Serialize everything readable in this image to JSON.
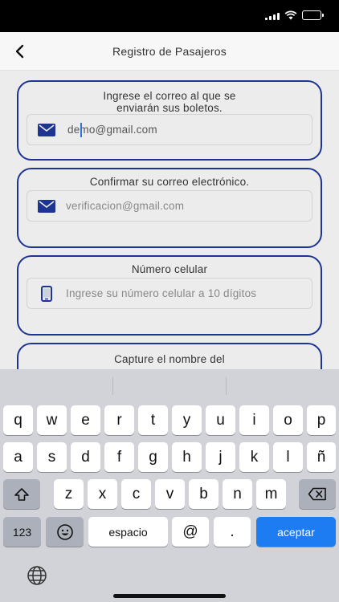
{
  "status_bar": {
    "icons": [
      "signal-icon",
      "wifi-icon",
      "battery-icon"
    ]
  },
  "nav": {
    "title": "Registro de Pasajeros",
    "back_icon": "chevron-left-icon"
  },
  "form": {
    "email_card": {
      "label": "Ingrese el correo al que se enviarán sus boletos.",
      "value": "demo@gmail.com",
      "icon": "mail-icon"
    },
    "confirm_card": {
      "label": "Confirmar su correo electrónico.",
      "placeholder": "verificacion@gmail.com",
      "icon": "mail-icon"
    },
    "phone_card": {
      "label": "Número celular",
      "placeholder": "Ingrese su número celular a 10 dígitos",
      "icon": "phone-icon"
    },
    "name_card": {
      "label": "Capture el nombre del"
    }
  },
  "keyboard": {
    "row1": [
      "q",
      "w",
      "e",
      "r",
      "t",
      "y",
      "u",
      "i",
      "o",
      "p"
    ],
    "row2": [
      "a",
      "s",
      "d",
      "f",
      "g",
      "h",
      "j",
      "k",
      "l",
      "ñ"
    ],
    "row3": [
      "z",
      "x",
      "c",
      "v",
      "b",
      "n",
      "m"
    ],
    "numbers_key": "123",
    "space_key": "espacio",
    "at_key": "@",
    "dot_key": ".",
    "return_key": "aceptar",
    "colors": {
      "background": "#d1d3d9",
      "key": "#ffffff",
      "special_key": "#abb0ba",
      "return_key": "#1e7cf2"
    }
  },
  "colors": {
    "card_border": "#1d3493",
    "icon": "#1d3493",
    "background": "#ececec"
  }
}
